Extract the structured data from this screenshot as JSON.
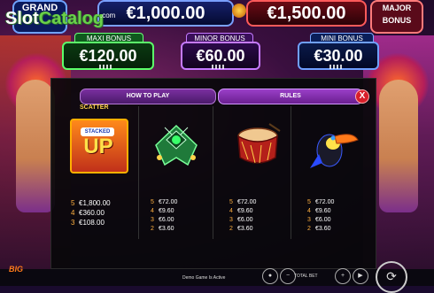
{
  "watermark": {
    "slot": "Slot",
    "catalog": "Catalog",
    "sub": ".com"
  },
  "jackpots": {
    "grand_label": "GRAND",
    "grand_amount": "€1,000.00",
    "major_amount": "€1,500.00",
    "major_label": "MAJOR",
    "major_sub": "BONUS"
  },
  "bonuses": {
    "maxi": {
      "label": "MAXI BONUS",
      "amount": "€120.00"
    },
    "minor": {
      "label": "MINOR BONUS",
      "amount": "€60.00"
    },
    "mini": {
      "label": "MINI BONUS",
      "amount": "€30.00"
    }
  },
  "tabs": {
    "how_to_play": "HOW TO PLAY",
    "rules": "RULES",
    "close": "X"
  },
  "scatter_label": "SCATTER",
  "stacked_up": {
    "top": "STACKED",
    "word": "UP"
  },
  "paytable": [
    {
      "symbol": "scatter-stacked-up",
      "rows": [
        {
          "n": "5",
          "v": "€1,800.00"
        },
        {
          "n": "4",
          "v": "€360.00"
        },
        {
          "n": "3",
          "v": "€108.00"
        }
      ]
    },
    {
      "symbol": "jeweled-mask",
      "rows": [
        {
          "n": "5",
          "v": "€72.00"
        },
        {
          "n": "4",
          "v": "€9.60"
        },
        {
          "n": "3",
          "v": "€6.00"
        },
        {
          "n": "2",
          "v": "€3.60"
        }
      ]
    },
    {
      "symbol": "drum",
      "rows": [
        {
          "n": "5",
          "v": "€72.00"
        },
        {
          "n": "4",
          "v": "€9.60"
        },
        {
          "n": "3",
          "v": "€6.00"
        },
        {
          "n": "2",
          "v": "€3.60"
        }
      ]
    },
    {
      "symbol": "toucan",
      "rows": [
        {
          "n": "5",
          "v": "€72.00"
        },
        {
          "n": "4",
          "v": "€9.60"
        },
        {
          "n": "3",
          "v": "€6.00"
        },
        {
          "n": "2",
          "v": "€3.60"
        }
      ]
    }
  ],
  "bottom": {
    "logo": "BIG",
    "demo_text": "Demo Game Is Active",
    "total_bet_label": "TOTAL BET"
  },
  "colors": {
    "accent": "#ffd24a",
    "rules_tab": "#9a3fc8",
    "close": "#d81f2a"
  }
}
